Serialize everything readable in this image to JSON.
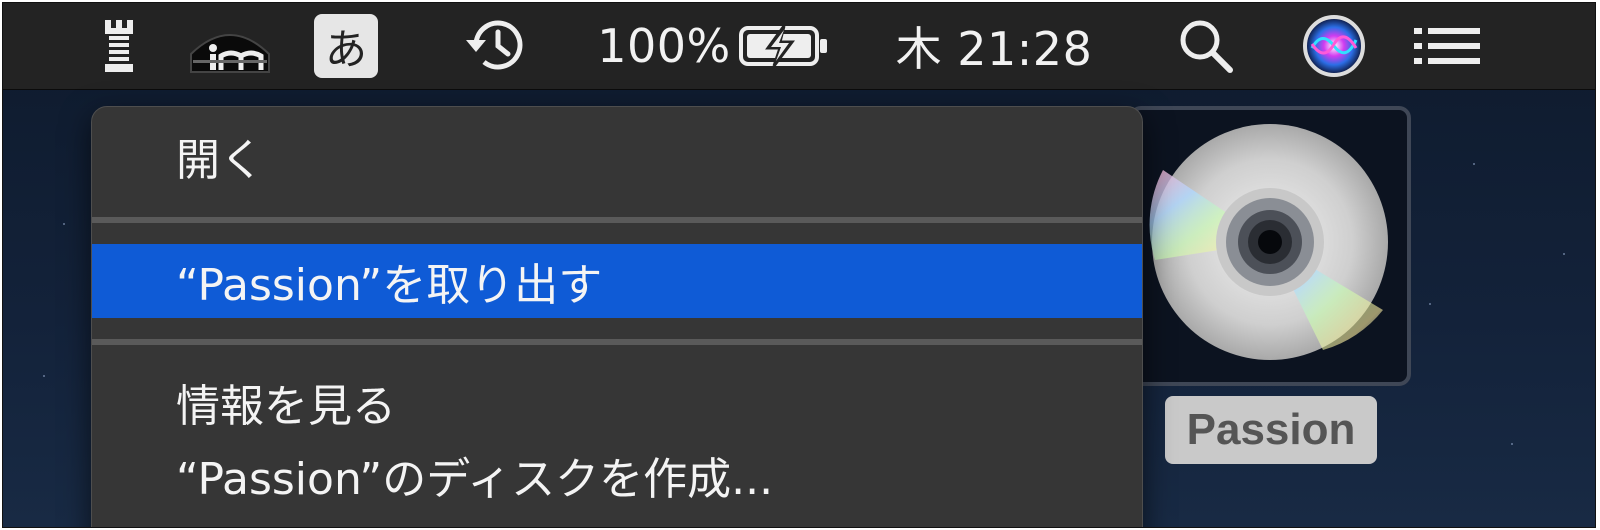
{
  "menubar": {
    "ime_label": "あ",
    "battery_percent": "100%",
    "clock": "木 21:28",
    "icons": [
      "rook-icon",
      "app-logo-icon",
      "input-method-icon",
      "time-machine-icon",
      "battery-charging-icon",
      "search-icon",
      "siri-icon",
      "notification-center-icon"
    ]
  },
  "context_menu": {
    "items": [
      {
        "label": "開く"
      },
      {
        "label": "“Passion”を取り出す",
        "selected": true
      },
      {
        "label": "情報を見る"
      },
      {
        "label": "“Passion”のディスクを作成..."
      }
    ]
  },
  "desktop": {
    "disk_name": "Passion",
    "disk_icon": "cd-disc-icon"
  },
  "colors": {
    "menubar_bg": "#232323",
    "menu_bg": "#363636",
    "selection": "#0f5bd6"
  }
}
